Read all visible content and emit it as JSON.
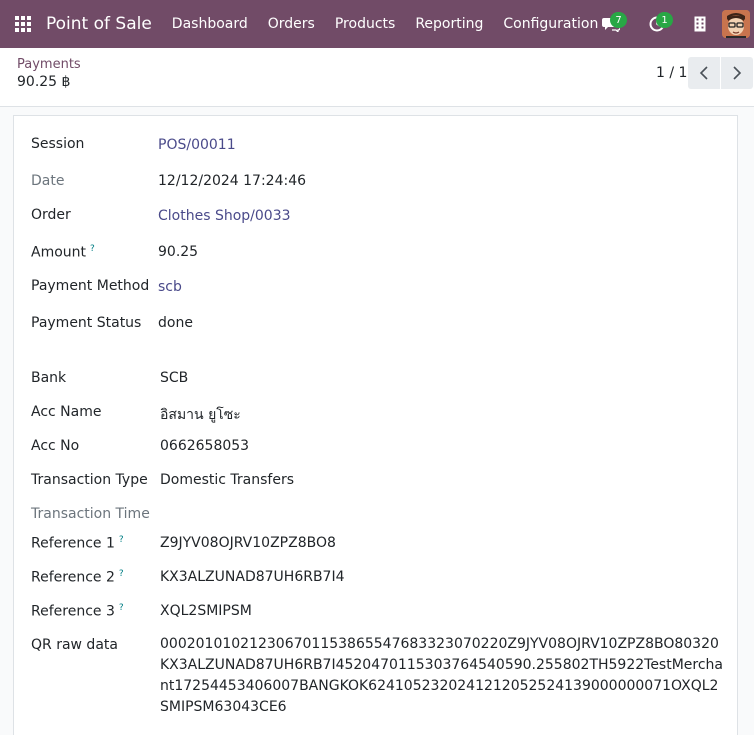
{
  "navbar": {
    "brand": "Point of Sale",
    "menu": [
      "Dashboard",
      "Orders",
      "Products",
      "Reporting",
      "Configuration"
    ],
    "chat_count": "7",
    "activity_count": "1"
  },
  "control_panel": {
    "breadcrumb": "Payments",
    "record_title": "90.25 ฿",
    "pager": "1 / 1"
  },
  "form": {
    "session": {
      "label": "Session",
      "value": "POS/00011"
    },
    "date": {
      "label": "Date",
      "value": "12/12/2024 17:24:46"
    },
    "order": {
      "label": "Order",
      "value": "Clothes Shop/0033"
    },
    "amount": {
      "label": "Amount",
      "help": "?",
      "value": "90.25"
    },
    "payment_method": {
      "label": "Payment Method",
      "value": "scb"
    },
    "payment_status": {
      "label": "Payment Status",
      "value": "done"
    },
    "bank": {
      "label": "Bank",
      "value": "SCB"
    },
    "acc_name": {
      "label": "Acc Name",
      "value": "อิสมาน ยูโซะ"
    },
    "acc_no": {
      "label": "Acc No",
      "value": "0662658053"
    },
    "transaction_type": {
      "label": "Transaction Type",
      "value": "Domestic Transfers"
    },
    "transaction_time": {
      "label": "Transaction Time",
      "value": ""
    },
    "reference_1": {
      "label": "Reference 1",
      "help": "?",
      "value": "Z9JYV08OJRV10ZPZ8BO8"
    },
    "reference_2": {
      "label": "Reference 2",
      "help": "?",
      "value": "KX3ALZUNAD87UH6RB7I4"
    },
    "reference_3": {
      "label": "Reference 3",
      "help": "?",
      "value": "XQL2SMIPSM"
    },
    "qr_raw_data": {
      "label": "QR raw data",
      "value": "000201010212306701153865547683323070220Z9JYV08OJRV10ZPZ8BO80320KX3ALZUNAD87UH6RB7I4520470115303764540590.255802TH5922TestMerchant17254453406007BANGKOK6241052320241212052524139000000071OXQL2SMIPSM63043CE6"
    }
  },
  "colors": {
    "navbar": "#714b67",
    "link": "#4a4a8a",
    "badge": "#28a745",
    "help": "#017e84"
  }
}
